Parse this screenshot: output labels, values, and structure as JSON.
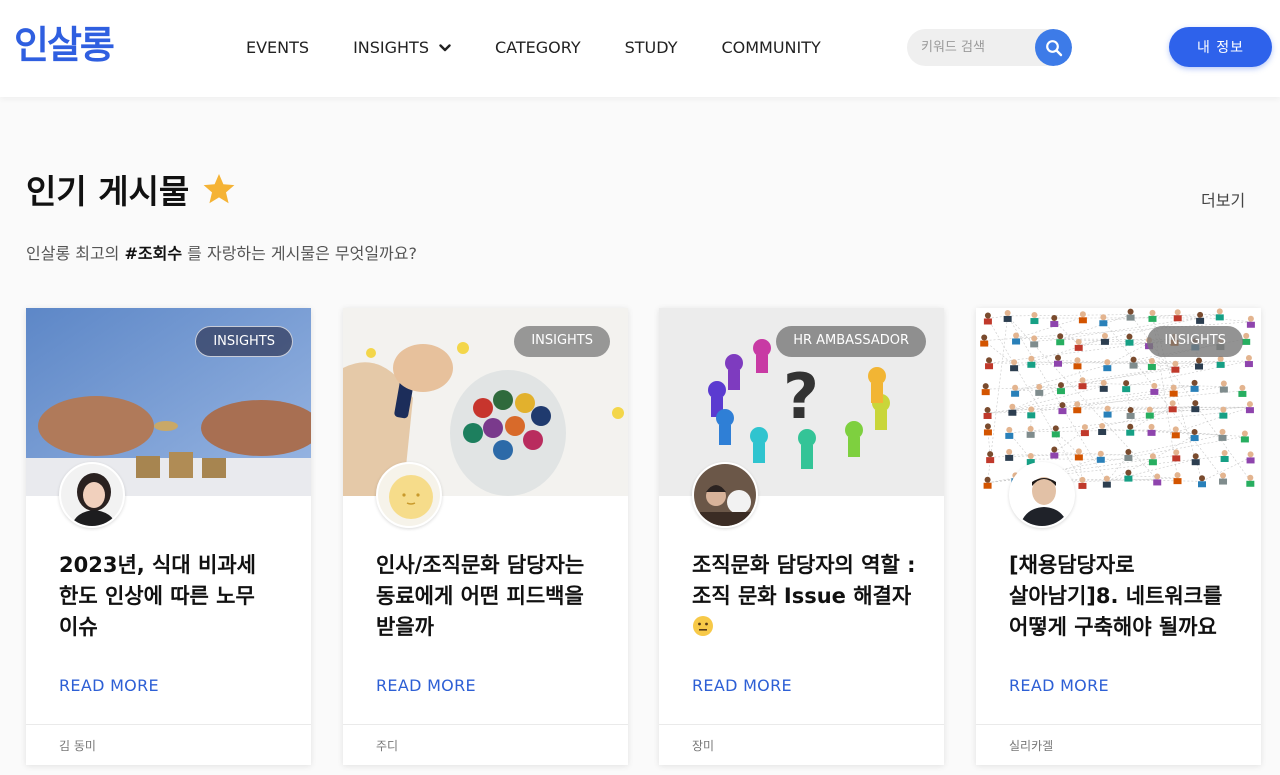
{
  "header": {
    "logo": "인살롱",
    "nav": [
      "EVENTS",
      "INSIGHTS",
      "CATEGORY",
      "STUDY",
      "COMMUNITY"
    ],
    "search_placeholder": "키워드 검색",
    "profile_button": "내 정보"
  },
  "section": {
    "title": "인기 게시물",
    "more": "더보기",
    "subtitle_before": "인살롱 최고의 ",
    "subtitle_tag": "#조회수",
    "subtitle_after": " 를 자랑하는 게시물은 무엇일까요?"
  },
  "read_more_label": "READ MORE",
  "cards": [
    {
      "badge": "INSIGHTS",
      "title": "2023년, 식대 비과세 한도 인상에 따른 노무 이슈",
      "author": "김 동미"
    },
    {
      "badge": "INSIGHTS",
      "title": "인사/조직문화 담당자는 동료에게 어떤 피드백을 받을까",
      "author": "주디"
    },
    {
      "badge": "HR AMBASSADOR",
      "title": "조직문화 담당자의 역할 : 조직 문화 Issue 해결자",
      "author": "장미"
    },
    {
      "badge": "INSIGHTS",
      "title": "[채용담당자로 살아남기]8. 네트워크를 어떻게 구축해야 될까요",
      "author": "실리카겔"
    }
  ],
  "colors": {
    "accent": "#2e62eb",
    "link": "#2d5fd5",
    "star": "#f5b335"
  }
}
